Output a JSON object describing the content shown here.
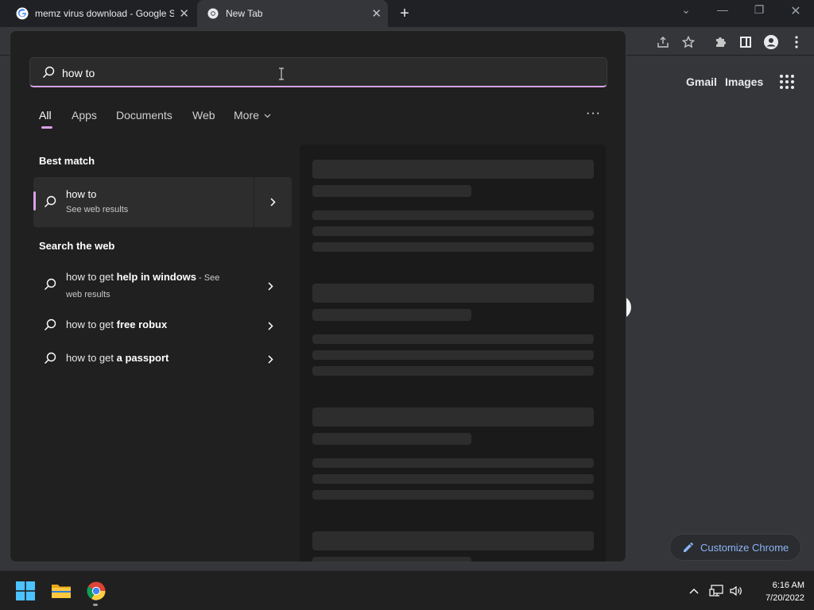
{
  "browser": {
    "tabs": [
      {
        "title": "memz virus download - Google S",
        "active": false,
        "icon": "google-favicon"
      },
      {
        "title": "New Tab",
        "active": true,
        "icon": "chrome-favicon"
      }
    ],
    "ntp_links": [
      "Gmail",
      "Images"
    ],
    "customize_label": "Customize Chrome"
  },
  "search": {
    "query": "how to ",
    "filters": [
      "All",
      "Apps",
      "Documents",
      "Web",
      "More"
    ],
    "active_filter": "All",
    "best_match_heading": "Best match",
    "best_match": {
      "title": "how to",
      "subtitle": "See web results"
    },
    "web_heading": "Search the web",
    "web_results": [
      {
        "prefix": "how to get ",
        "bold": "help in windows",
        "suffix_line1": " - See",
        "suffix_line2": "web results"
      },
      {
        "prefix": "how to get ",
        "bold": "free robux"
      },
      {
        "prefix": "how to get ",
        "bold": "a passport"
      }
    ],
    "more_options": "···"
  },
  "taskbar": {
    "time": "6:16 AM",
    "date": "7/20/2022",
    "pinned": [
      "windows-start-icon",
      "file-explorer-icon",
      "chrome-icon"
    ]
  },
  "colors": {
    "accent": "#d9a1e6",
    "flyout_bg": "#202020",
    "chrome_bg": "#35363a",
    "link_blue": "#8ab4f8"
  }
}
